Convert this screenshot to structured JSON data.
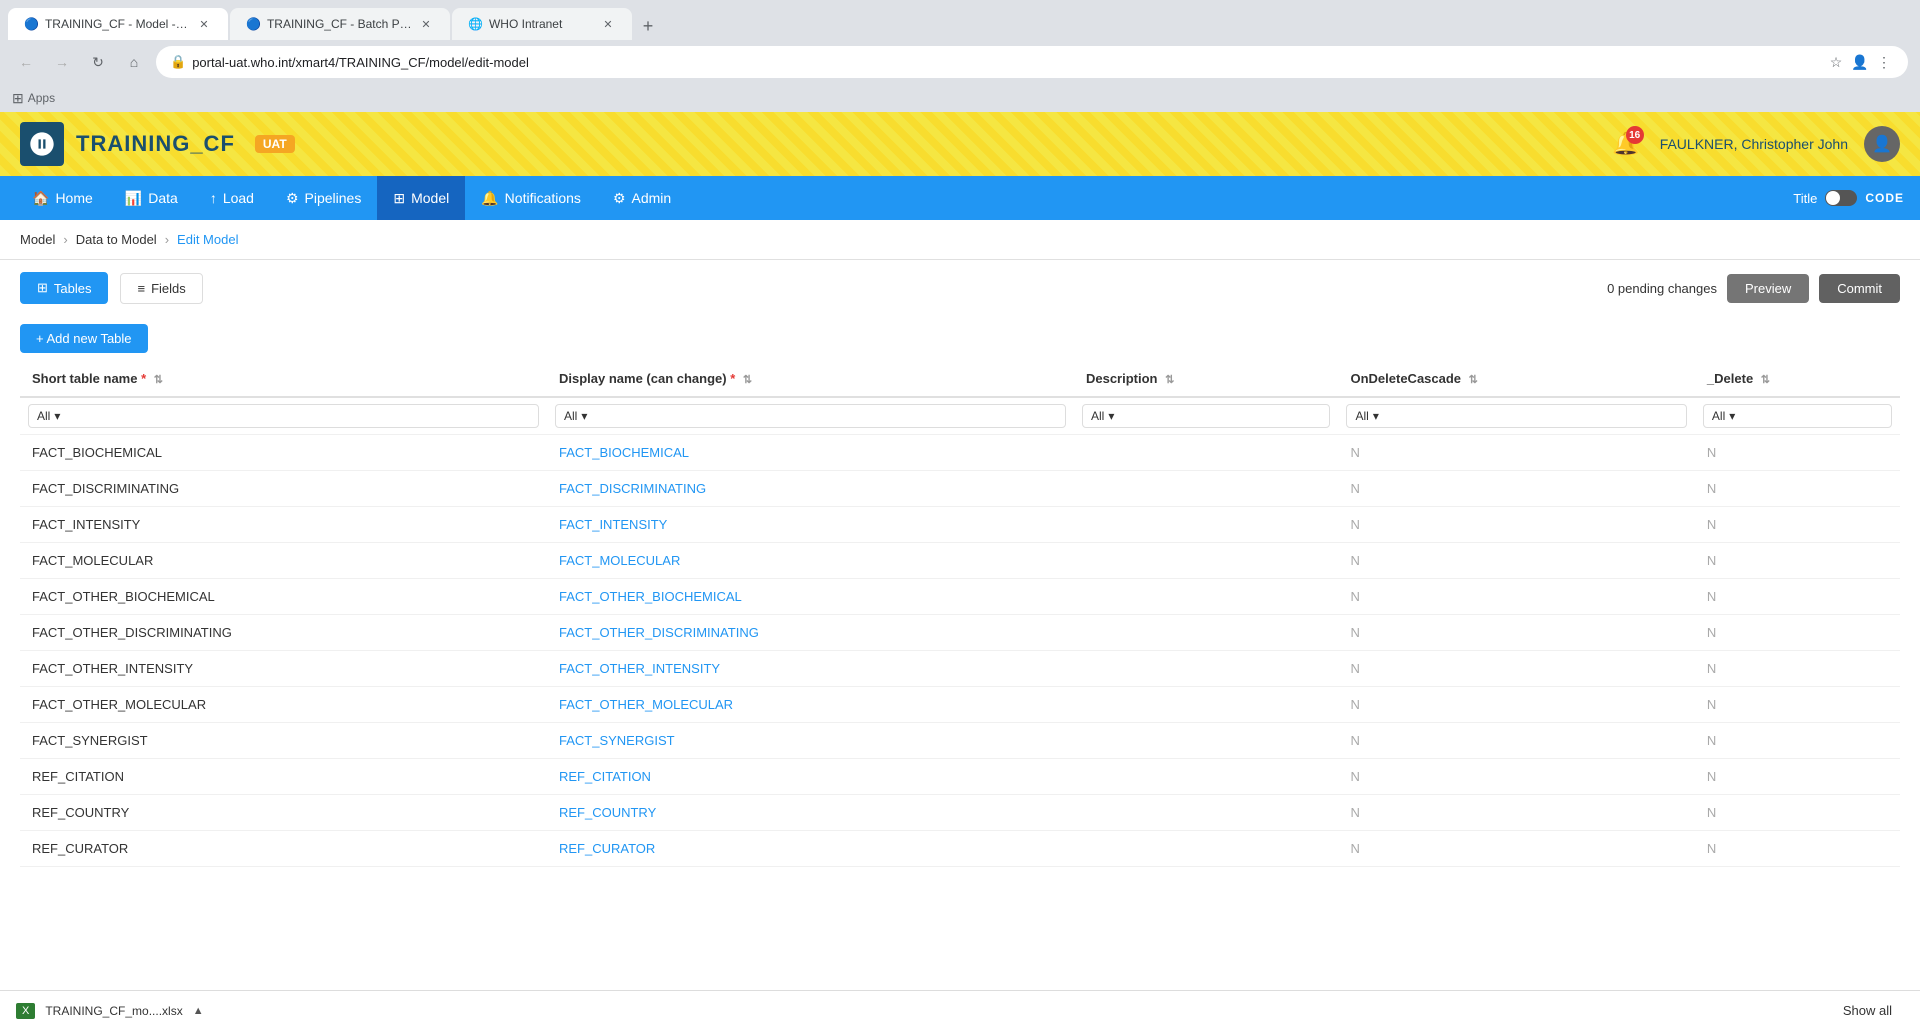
{
  "browser": {
    "tabs": [
      {
        "id": 1,
        "title": "TRAINING_CF - Model - Edit",
        "active": true,
        "favicon": "🔵"
      },
      {
        "id": 2,
        "title": "TRAINING_CF - Batch Preview",
        "active": false,
        "favicon": "🔵"
      },
      {
        "id": 3,
        "title": "WHO Intranet",
        "active": false,
        "favicon": "🌐"
      }
    ],
    "url": "portal-uat.who.int/xmart4/TRAINING_CF/model/edit-model",
    "apps_label": "Apps"
  },
  "header": {
    "app_name": "TRAINING_CF",
    "badge": "UAT",
    "notification_count": "16",
    "user_name": "FAULKNER, Christopher John"
  },
  "nav": {
    "items": [
      {
        "id": "home",
        "label": "Home",
        "icon": "🏠",
        "active": false
      },
      {
        "id": "data",
        "label": "Data",
        "icon": "📊",
        "active": false
      },
      {
        "id": "load",
        "label": "Load",
        "icon": "⬆",
        "active": false
      },
      {
        "id": "pipelines",
        "label": "Pipelines",
        "icon": "⚙",
        "active": false
      },
      {
        "id": "model",
        "label": "Model",
        "icon": "⊞",
        "active": true
      },
      {
        "id": "notifications",
        "label": "Notifications",
        "icon": "🔔",
        "active": false
      },
      {
        "id": "admin",
        "label": "Admin",
        "icon": "⚙",
        "active": false
      }
    ],
    "title_label": "Title",
    "code_label": "CODE"
  },
  "breadcrumb": {
    "items": [
      {
        "label": "Model",
        "active": false
      },
      {
        "label": "Data to Model",
        "active": false
      },
      {
        "label": "Edit Model",
        "active": true
      }
    ]
  },
  "toolbar": {
    "tabs": [
      {
        "id": "tables",
        "label": "Tables",
        "icon": "⊞",
        "active": true
      },
      {
        "id": "fields",
        "label": "Fields",
        "icon": "≡",
        "active": false
      }
    ],
    "pending_label": "0 pending changes",
    "preview_label": "Preview",
    "commit_label": "Commit"
  },
  "add_table": {
    "label": "+ Add new Table"
  },
  "table": {
    "columns": [
      {
        "id": "short_name",
        "label": "Short table name",
        "required": true,
        "sortable": true
      },
      {
        "id": "display_name",
        "label": "Display name (can change)",
        "required": true,
        "sortable": true
      },
      {
        "id": "description",
        "label": "Description",
        "required": false,
        "sortable": true
      },
      {
        "id": "on_delete_cascade",
        "label": "OnDeleteCascade",
        "required": false,
        "sortable": true
      },
      {
        "id": "delete",
        "label": "_Delete",
        "required": false,
        "sortable": true
      }
    ],
    "filters": {
      "short_name": "All",
      "display_name": "All",
      "description": "All",
      "on_delete_cascade": "All",
      "delete": "All"
    },
    "rows": [
      {
        "short_name": "FACT_BIOCHEMICAL",
        "display_name": "FACT_BIOCHEMICAL",
        "description": "",
        "on_delete_cascade": "N",
        "delete": "N"
      },
      {
        "short_name": "FACT_DISCRIMINATING",
        "display_name": "FACT_DISCRIMINATING",
        "description": "",
        "on_delete_cascade": "N",
        "delete": "N"
      },
      {
        "short_name": "FACT_INTENSITY",
        "display_name": "FACT_INTENSITY",
        "description": "",
        "on_delete_cascade": "N",
        "delete": "N"
      },
      {
        "short_name": "FACT_MOLECULAR",
        "display_name": "FACT_MOLECULAR",
        "description": "",
        "on_delete_cascade": "N",
        "delete": "N"
      },
      {
        "short_name": "FACT_OTHER_BIOCHEMICAL",
        "display_name": "FACT_OTHER_BIOCHEMICAL",
        "description": "",
        "on_delete_cascade": "N",
        "delete": "N"
      },
      {
        "short_name": "FACT_OTHER_DISCRIMINATING",
        "display_name": "FACT_OTHER_DISCRIMINATING",
        "description": "",
        "on_delete_cascade": "N",
        "delete": "N"
      },
      {
        "short_name": "FACT_OTHER_INTENSITY",
        "display_name": "FACT_OTHER_INTENSITY",
        "description": "",
        "on_delete_cascade": "N",
        "delete": "N"
      },
      {
        "short_name": "FACT_OTHER_MOLECULAR",
        "display_name": "FACT_OTHER_MOLECULAR",
        "description": "",
        "on_delete_cascade": "N",
        "delete": "N"
      },
      {
        "short_name": "FACT_SYNERGIST",
        "display_name": "FACT_SYNERGIST",
        "description": "",
        "on_delete_cascade": "N",
        "delete": "N"
      },
      {
        "short_name": "REF_CITATION",
        "display_name": "REF_CITATION",
        "description": "",
        "on_delete_cascade": "N",
        "delete": "N"
      },
      {
        "short_name": "REF_COUNTRY",
        "display_name": "REF_COUNTRY",
        "description": "",
        "on_delete_cascade": "N",
        "delete": "N"
      },
      {
        "short_name": "REF_CURATOR",
        "display_name": "REF_CURATOR",
        "description": "",
        "on_delete_cascade": "N",
        "delete": "N"
      }
    ]
  },
  "bottom_bar": {
    "file_name": "TRAINING_CF_mo....xlsx",
    "show_all_label": "Show all"
  }
}
